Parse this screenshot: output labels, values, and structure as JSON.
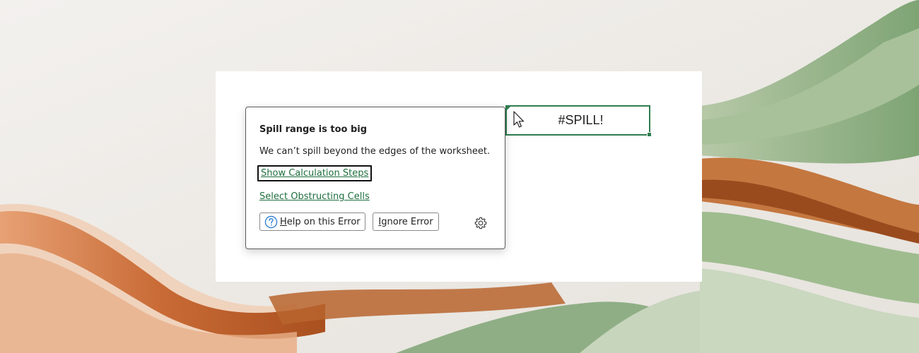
{
  "colors": {
    "accent_green": "#1e6e3d",
    "cell_border": "#2f7d4f",
    "help_icon": "#2b7cd3"
  },
  "cell": {
    "value": "#SPILL!"
  },
  "popup": {
    "title": "Spill range is too big",
    "message": "We can’t spill beyond the edges of the worksheet.",
    "links": {
      "show_calc_steps": "Show Calculation Steps",
      "select_obstructing": "Select Obstructing Cells"
    },
    "buttons": {
      "help_prefix": "",
      "help_accel": "H",
      "help_rest": "elp on this Error",
      "ignore_accel": "I",
      "ignore_rest": "gnore Error"
    },
    "icons": {
      "help": "question-circle-icon",
      "settings": "gear-icon",
      "cursor": "mouse-pointer-icon"
    }
  }
}
